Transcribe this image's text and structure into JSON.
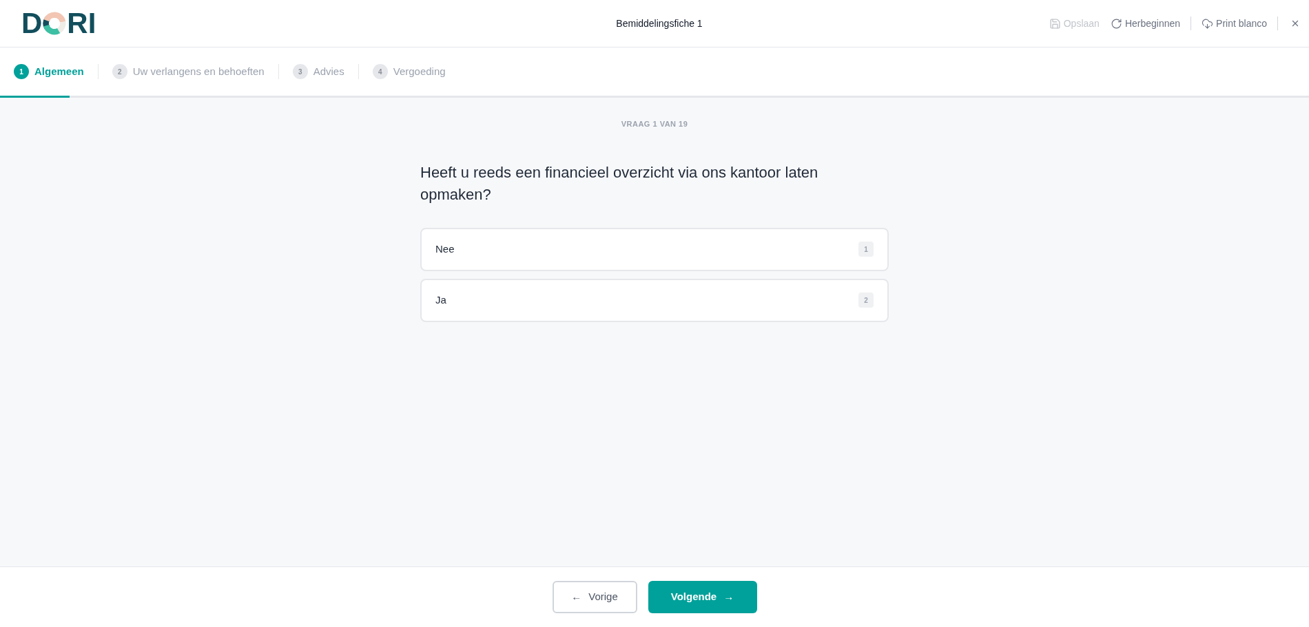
{
  "header": {
    "logo": {
      "lead": "D",
      "tail": "RI"
    },
    "title": "Bemiddelingsfiche 1",
    "action_groups": [
      [
        {
          "kind": "save",
          "label": "Opslaan",
          "disabled": true
        },
        {
          "kind": "restart",
          "label": "Herbeginnen",
          "disabled": false
        }
      ],
      [
        {
          "kind": "print",
          "label": "Print blanco",
          "disabled": false
        }
      ]
    ]
  },
  "steps": [
    {
      "number": "1",
      "label": "Algemeen",
      "selected": true
    },
    {
      "number": "2",
      "label": "Uw verlangens en behoeften",
      "selected": false
    },
    {
      "number": "3",
      "label": "Advies",
      "selected": false
    },
    {
      "number": "4",
      "label": "Vergoeding",
      "selected": false
    }
  ],
  "progress": {
    "level": 0.053
  },
  "question": {
    "counter": "VRAAG 1 VAN 19",
    "text": "Heeft u reeds een financieel overzicht via ons kantoor laten opmaken?",
    "options": [
      {
        "label": "Nee",
        "shortcut": "1",
        "selected": false
      },
      {
        "label": "Ja",
        "shortcut": "2",
        "selected": false
      }
    ]
  },
  "footer": {
    "back": {
      "arrow": "←",
      "label": "Vorige"
    },
    "next": {
      "label": "Volgende",
      "arrow": "→"
    }
  }
}
